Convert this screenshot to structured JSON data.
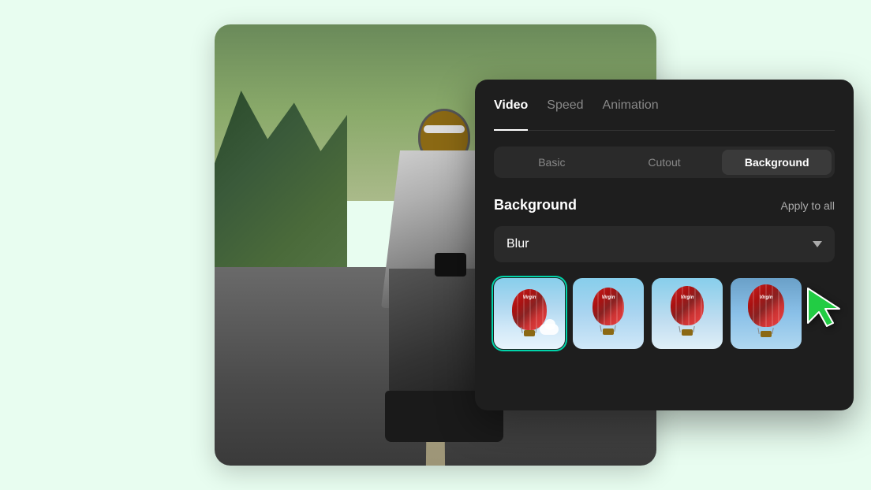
{
  "app": {
    "bg_color": "#e8fdf0"
  },
  "tabs": {
    "items": [
      {
        "id": "video",
        "label": "Video",
        "active": true
      },
      {
        "id": "speed",
        "label": "Speed",
        "active": false
      },
      {
        "id": "animation",
        "label": "Animation",
        "active": false
      }
    ]
  },
  "sub_tabs": {
    "items": [
      {
        "id": "basic",
        "label": "Basic",
        "active": false
      },
      {
        "id": "cutout",
        "label": "Cutout",
        "active": false
      },
      {
        "id": "background",
        "label": "Background",
        "active": true
      }
    ]
  },
  "section": {
    "title": "Background",
    "apply_all_label": "Apply to all"
  },
  "dropdown": {
    "value": "Blur",
    "chevron": "▾"
  },
  "thumbnails": [
    {
      "id": 1,
      "selected": true,
      "alt": "hot-air-balloon-1"
    },
    {
      "id": 2,
      "selected": false,
      "alt": "hot-air-balloon-2"
    },
    {
      "id": 3,
      "selected": false,
      "alt": "hot-air-balloon-3"
    },
    {
      "id": 4,
      "selected": false,
      "alt": "hot-air-balloon-4"
    }
  ],
  "cursor": {
    "color": "#22cc44"
  }
}
